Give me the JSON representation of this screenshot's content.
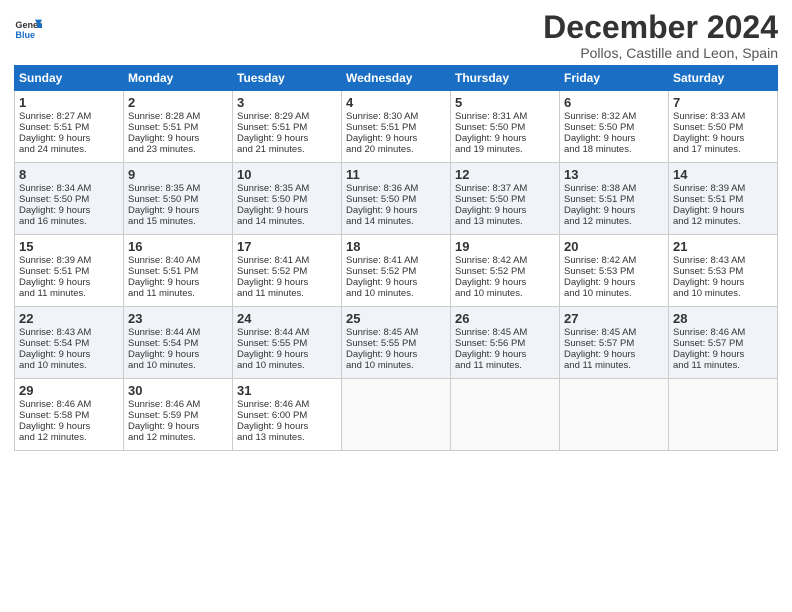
{
  "logo": {
    "line1": "General",
    "line2": "Blue"
  },
  "title": "December 2024",
  "subtitle": "Pollos, Castille and Leon, Spain",
  "headers": [
    "Sunday",
    "Monday",
    "Tuesday",
    "Wednesday",
    "Thursday",
    "Friday",
    "Saturday"
  ],
  "weeks": [
    [
      {
        "day": "1",
        "lines": [
          "Sunrise: 8:27 AM",
          "Sunset: 5:51 PM",
          "Daylight: 9 hours",
          "and 24 minutes."
        ]
      },
      {
        "day": "2",
        "lines": [
          "Sunrise: 8:28 AM",
          "Sunset: 5:51 PM",
          "Daylight: 9 hours",
          "and 23 minutes."
        ]
      },
      {
        "day": "3",
        "lines": [
          "Sunrise: 8:29 AM",
          "Sunset: 5:51 PM",
          "Daylight: 9 hours",
          "and 21 minutes."
        ]
      },
      {
        "day": "4",
        "lines": [
          "Sunrise: 8:30 AM",
          "Sunset: 5:51 PM",
          "Daylight: 9 hours",
          "and 20 minutes."
        ]
      },
      {
        "day": "5",
        "lines": [
          "Sunrise: 8:31 AM",
          "Sunset: 5:50 PM",
          "Daylight: 9 hours",
          "and 19 minutes."
        ]
      },
      {
        "day": "6",
        "lines": [
          "Sunrise: 8:32 AM",
          "Sunset: 5:50 PM",
          "Daylight: 9 hours",
          "and 18 minutes."
        ]
      },
      {
        "day": "7",
        "lines": [
          "Sunrise: 8:33 AM",
          "Sunset: 5:50 PM",
          "Daylight: 9 hours",
          "and 17 minutes."
        ]
      }
    ],
    [
      {
        "day": "8",
        "lines": [
          "Sunrise: 8:34 AM",
          "Sunset: 5:50 PM",
          "Daylight: 9 hours",
          "and 16 minutes."
        ]
      },
      {
        "day": "9",
        "lines": [
          "Sunrise: 8:35 AM",
          "Sunset: 5:50 PM",
          "Daylight: 9 hours",
          "and 15 minutes."
        ]
      },
      {
        "day": "10",
        "lines": [
          "Sunrise: 8:35 AM",
          "Sunset: 5:50 PM",
          "Daylight: 9 hours",
          "and 14 minutes."
        ]
      },
      {
        "day": "11",
        "lines": [
          "Sunrise: 8:36 AM",
          "Sunset: 5:50 PM",
          "Daylight: 9 hours",
          "and 14 minutes."
        ]
      },
      {
        "day": "12",
        "lines": [
          "Sunrise: 8:37 AM",
          "Sunset: 5:50 PM",
          "Daylight: 9 hours",
          "and 13 minutes."
        ]
      },
      {
        "day": "13",
        "lines": [
          "Sunrise: 8:38 AM",
          "Sunset: 5:51 PM",
          "Daylight: 9 hours",
          "and 12 minutes."
        ]
      },
      {
        "day": "14",
        "lines": [
          "Sunrise: 8:39 AM",
          "Sunset: 5:51 PM",
          "Daylight: 9 hours",
          "and 12 minutes."
        ]
      }
    ],
    [
      {
        "day": "15",
        "lines": [
          "Sunrise: 8:39 AM",
          "Sunset: 5:51 PM",
          "Daylight: 9 hours",
          "and 11 minutes."
        ]
      },
      {
        "day": "16",
        "lines": [
          "Sunrise: 8:40 AM",
          "Sunset: 5:51 PM",
          "Daylight: 9 hours",
          "and 11 minutes."
        ]
      },
      {
        "day": "17",
        "lines": [
          "Sunrise: 8:41 AM",
          "Sunset: 5:52 PM",
          "Daylight: 9 hours",
          "and 11 minutes."
        ]
      },
      {
        "day": "18",
        "lines": [
          "Sunrise: 8:41 AM",
          "Sunset: 5:52 PM",
          "Daylight: 9 hours",
          "and 10 minutes."
        ]
      },
      {
        "day": "19",
        "lines": [
          "Sunrise: 8:42 AM",
          "Sunset: 5:52 PM",
          "Daylight: 9 hours",
          "and 10 minutes."
        ]
      },
      {
        "day": "20",
        "lines": [
          "Sunrise: 8:42 AM",
          "Sunset: 5:53 PM",
          "Daylight: 9 hours",
          "and 10 minutes."
        ]
      },
      {
        "day": "21",
        "lines": [
          "Sunrise: 8:43 AM",
          "Sunset: 5:53 PM",
          "Daylight: 9 hours",
          "and 10 minutes."
        ]
      }
    ],
    [
      {
        "day": "22",
        "lines": [
          "Sunrise: 8:43 AM",
          "Sunset: 5:54 PM",
          "Daylight: 9 hours",
          "and 10 minutes."
        ]
      },
      {
        "day": "23",
        "lines": [
          "Sunrise: 8:44 AM",
          "Sunset: 5:54 PM",
          "Daylight: 9 hours",
          "and 10 minutes."
        ]
      },
      {
        "day": "24",
        "lines": [
          "Sunrise: 8:44 AM",
          "Sunset: 5:55 PM",
          "Daylight: 9 hours",
          "and 10 minutes."
        ]
      },
      {
        "day": "25",
        "lines": [
          "Sunrise: 8:45 AM",
          "Sunset: 5:55 PM",
          "Daylight: 9 hours",
          "and 10 minutes."
        ]
      },
      {
        "day": "26",
        "lines": [
          "Sunrise: 8:45 AM",
          "Sunset: 5:56 PM",
          "Daylight: 9 hours",
          "and 11 minutes."
        ]
      },
      {
        "day": "27",
        "lines": [
          "Sunrise: 8:45 AM",
          "Sunset: 5:57 PM",
          "Daylight: 9 hours",
          "and 11 minutes."
        ]
      },
      {
        "day": "28",
        "lines": [
          "Sunrise: 8:46 AM",
          "Sunset: 5:57 PM",
          "Daylight: 9 hours",
          "and 11 minutes."
        ]
      }
    ],
    [
      {
        "day": "29",
        "lines": [
          "Sunrise: 8:46 AM",
          "Sunset: 5:58 PM",
          "Daylight: 9 hours",
          "and 12 minutes."
        ]
      },
      {
        "day": "30",
        "lines": [
          "Sunrise: 8:46 AM",
          "Sunset: 5:59 PM",
          "Daylight: 9 hours",
          "and 12 minutes."
        ]
      },
      {
        "day": "31",
        "lines": [
          "Sunrise: 8:46 AM",
          "Sunset: 6:00 PM",
          "Daylight: 9 hours",
          "and 13 minutes."
        ]
      },
      null,
      null,
      null,
      null
    ]
  ]
}
